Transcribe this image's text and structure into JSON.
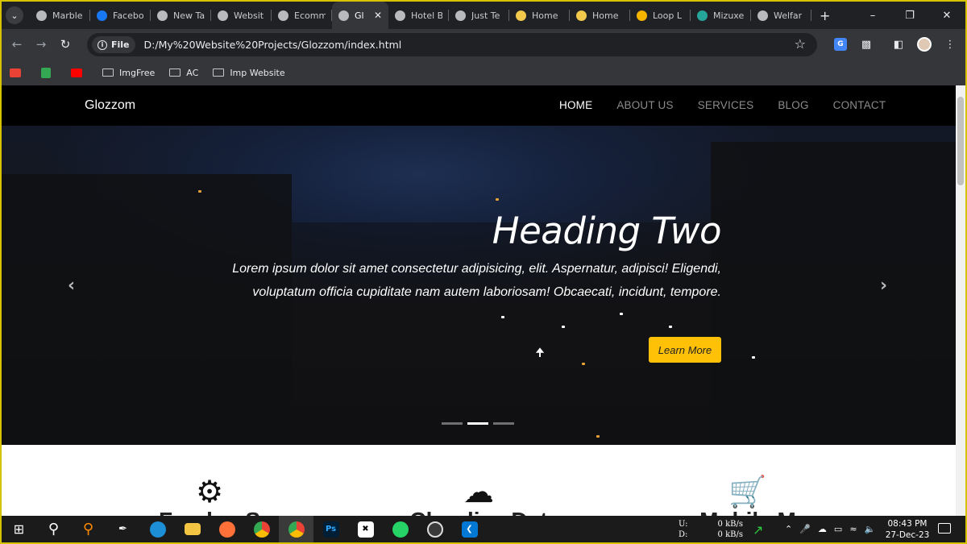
{
  "browser": {
    "tabs": [
      {
        "title": "Marble",
        "active": false
      },
      {
        "title": "Facebo",
        "active": false
      },
      {
        "title": "New Ta",
        "active": false
      },
      {
        "title": "Websit",
        "active": false
      },
      {
        "title": "Ecomm",
        "active": false
      },
      {
        "title": "Gl",
        "active": true
      },
      {
        "title": "Hotel B",
        "active": false
      },
      {
        "title": "Just Te",
        "active": false
      },
      {
        "title": "Home",
        "active": false
      },
      {
        "title": "Home",
        "active": false
      },
      {
        "title": "Loop L",
        "active": false
      },
      {
        "title": "Mizuxe",
        "active": false
      },
      {
        "title": "Welfar",
        "active": false
      }
    ],
    "file_chip": "File",
    "url": "D:/My%20Website%20Projects/Glozzom/index.html",
    "bookmarks": [
      {
        "label": "ImgFree"
      },
      {
        "label": "AC"
      },
      {
        "label": "Imp Website"
      }
    ]
  },
  "site": {
    "brand": "Glozzom",
    "nav": [
      {
        "label": "HOME",
        "active": true
      },
      {
        "label": "ABOUT US",
        "active": false
      },
      {
        "label": "SERVICES",
        "active": false
      },
      {
        "label": "BLOG",
        "active": false
      },
      {
        "label": "CONTACT",
        "active": false
      }
    ],
    "hero": {
      "heading": "Heading Two",
      "text": "Lorem ipsum dolor sit amet consectetur adipisicing, elit. Aspernatur, adipisci! Eligendi, voluptatum officia cupiditate nam autem laboriosam! Obcaecati, incidunt, tempore.",
      "button": "Learn More",
      "slides": 3,
      "active_slide": 2
    },
    "features": [
      {
        "icon": "cogs-icon",
        "title": "Freelan S"
      },
      {
        "icon": "cloud-icon",
        "title": "Cloudica Dat"
      },
      {
        "icon": "cart-plus-icon",
        "title": "Mobile M"
      }
    ]
  },
  "taskbar": {
    "net_up_label": "U:",
    "net_up": "0 kB/s",
    "net_down_label": "D:",
    "net_down": "0 kB/s",
    "time": "08:43 PM",
    "date": "27-Dec-23"
  },
  "colors": {
    "accent_button": "#ffc107",
    "navbar": "#000000",
    "browser_frame": "#202124"
  }
}
